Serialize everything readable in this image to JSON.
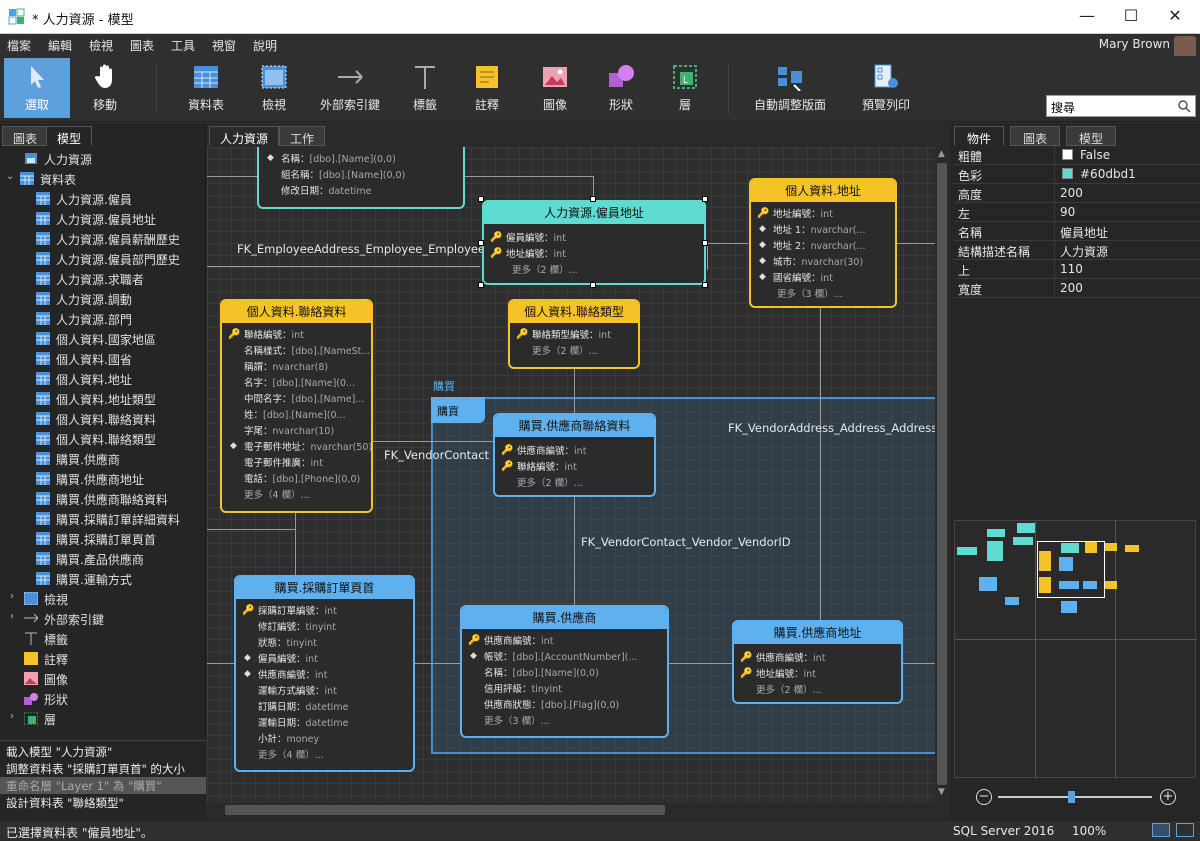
{
  "window": {
    "title": "* 人力資源 - 模型"
  },
  "menu": [
    "檔案",
    "編輯",
    "檢視",
    "圖表",
    "工具",
    "視窗",
    "說明"
  ],
  "user": {
    "name": "Mary Brown"
  },
  "toolbar": [
    "選取",
    "移動",
    "資料表",
    "檢視",
    "外部索引鍵",
    "標籤",
    "註釋",
    "圖像",
    "形狀",
    "層",
    "自動調整版面",
    "預覽列印"
  ],
  "search": {
    "placeholder": "搜尋"
  },
  "left_tabs": [
    "圖表",
    "模型"
  ],
  "tree": {
    "root": "人力資源",
    "tables_label": "資料表",
    "tables": [
      "人力資源.僱員",
      "人力資源.僱員地址",
      "人力資源.僱員薪酬歷史",
      "人力資源.僱員部門歷史",
      "人力資源.求職者",
      "人力資源.調動",
      "人力資源.部門",
      "個人資料.國家地區",
      "個人資料.國省",
      "個人資料.地址",
      "個人資料.地址類型",
      "個人資料.聯絡資料",
      "個人資料.聯絡類型",
      "購買.供應商",
      "購買.供應商地址",
      "購買.供應商聯絡資料",
      "購買.採購訂單詳細資料",
      "購買.採購訂單頁首",
      "購買.產品供應商",
      "購買.運輸方式"
    ],
    "others": [
      "檢視",
      "外部索引鍵",
      "標籤",
      "註釋",
      "圖像",
      "形狀",
      "層"
    ]
  },
  "log": [
    "載入模型 \"人力資源\"",
    "調整資料表 \"採購訂單頁首\" 的大小",
    "重命名層 \"Layer 1\" 為 \"購買\"",
    "設計資料表 \"聯絡類型\""
  ],
  "canvas_tabs": [
    "人力資源",
    "工作"
  ],
  "layer_label": "購買",
  "fk_labels": [
    "FK_EmployeeAddress_Employee_EmployeeID",
    "FK_VendorContact",
    "FK_VendorAddress_Address_AddressID",
    "FK_VendorContact_Vendor_VendorID"
  ],
  "entities": {
    "top_partial": {
      "rows": [
        [
          "名稱",
          "[dbo].[Name](0,0)"
        ],
        [
          "組名稱",
          "[dbo].[Name](0,0)"
        ],
        [
          "修改日期",
          "datetime"
        ]
      ]
    },
    "emp_addr": {
      "title": "人力資源.僱員地址",
      "rows": [
        [
          "僱員編號",
          "int"
        ],
        [
          "地址編號",
          "int"
        ]
      ],
      "more": "更多（2 欄）..."
    },
    "addr": {
      "title": "個人資料.地址",
      "rows": [
        [
          "地址編號",
          "int"
        ],
        [
          "地址 1",
          "nvarchar(..."
        ],
        [
          "地址 2",
          "nvarchar(..."
        ],
        [
          "城市",
          "nvarchar(30)"
        ],
        [
          "國省編號",
          "int"
        ]
      ],
      "more": "更多（3 欄）..."
    },
    "contact": {
      "title": "個人資料.聯絡資料",
      "rows": [
        [
          "聯絡編號",
          "int"
        ],
        [
          "名稱樣式",
          "[dbo].[NameSt..."
        ],
        [
          "稱謂",
          "nvarchar(8)"
        ],
        [
          "名字",
          "[dbo].[Name](0..."
        ],
        [
          "中間名字",
          "[dbo].[Name]..."
        ],
        [
          "姓",
          "[dbo].[Name](0..."
        ],
        [
          "字尾",
          "nvarchar(10)"
        ],
        [
          "電子郵件地址",
          "nvarchar(50)"
        ],
        [
          "電子郵件推廣",
          "int"
        ],
        [
          "電話",
          "[dbo].[Phone](0,0)"
        ]
      ],
      "more": "更多（4 欄）..."
    },
    "contact_type": {
      "title": "個人資料.聯絡類型",
      "rows": [
        [
          "聯絡類型編號",
          "int"
        ]
      ],
      "more": "更多（2 欄）..."
    },
    "vendor_contact": {
      "title": "購買.供應商聯絡資料",
      "rows": [
        [
          "供應商編號",
          "int"
        ],
        [
          "聯絡編號",
          "int"
        ]
      ],
      "more": "更多（2 欄）..."
    },
    "po_header": {
      "title": "購買.採購訂單頁首",
      "rows": [
        [
          "採購訂單編號",
          "int"
        ],
        [
          "修訂編號",
          "tinyint"
        ],
        [
          "狀態",
          "tinyint"
        ],
        [
          "僱員編號",
          "int"
        ],
        [
          "供應商編號",
          "int"
        ],
        [
          "運輸方式編號",
          "int"
        ],
        [
          "訂購日期",
          "datetime"
        ],
        [
          "運輸日期",
          "datetime"
        ],
        [
          "小計",
          "money"
        ]
      ],
      "more": "更多（4 欄）..."
    },
    "vendor": {
      "title": "購買.供應商",
      "rows": [
        [
          "供應商編號",
          "int"
        ],
        [
          "帳號",
          "[dbo].[AccountNumber](..."
        ],
        [
          "名稱",
          "[dbo].[Name](0,0)"
        ],
        [
          "信用評級",
          "tinyint"
        ],
        [
          "供應商狀態",
          "[dbo].[Flag](0,0)"
        ]
      ],
      "more": "更多（3 欄）..."
    },
    "vendor_addr": {
      "title": "購買.供應商地址",
      "rows": [
        [
          "供應商編號",
          "int"
        ],
        [
          "地址編號",
          "int"
        ]
      ],
      "more": "更多（2 欄）..."
    }
  },
  "right_tabs": [
    "物件",
    "圖表",
    "模型"
  ],
  "properties": [
    [
      "粗體",
      "False"
    ],
    [
      "色彩",
      "#60dbd1"
    ],
    [
      "高度",
      "200"
    ],
    [
      "左",
      "90"
    ],
    [
      "名稱",
      "僱員地址"
    ],
    [
      "結構描述名稱",
      "人力資源"
    ],
    [
      "上",
      "110"
    ],
    [
      "寬度",
      "200"
    ]
  ],
  "colors": {
    "accent": "#5ea0db",
    "cyan": "#60dbd1",
    "yellow": "#f5c328",
    "blue": "#5fb0ee"
  },
  "status": {
    "left": "已選擇資料表 \"僱員地址\"。",
    "db": "SQL Server 2016",
    "zoom": "100%"
  }
}
